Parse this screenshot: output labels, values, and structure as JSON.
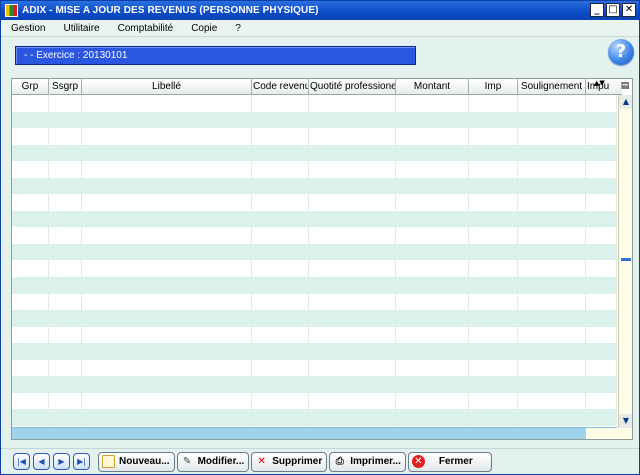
{
  "window": {
    "title": "ADIX - MISE A JOUR DES REVENUS (PERSONNE PHYSIQUE)",
    "minimize_glyph": "_",
    "maximize_glyph": "□",
    "close_glyph": "✕"
  },
  "menu": {
    "items": [
      {
        "label": "Gestion"
      },
      {
        "label": "Utilitaire"
      },
      {
        "label": "Comptabilité"
      },
      {
        "label": "Copie"
      },
      {
        "label": "?"
      }
    ]
  },
  "exercice": {
    "label": "- - Exercice : 20130101"
  },
  "grid": {
    "columns": [
      {
        "label": "Grp"
      },
      {
        "label": "Ssgrp"
      },
      {
        "label": "Libellé"
      },
      {
        "label": "Code revenu"
      },
      {
        "label": "Quotité professionelle"
      },
      {
        "label": "Montant"
      },
      {
        "label": "Imp"
      },
      {
        "label": "Soulignement"
      },
      {
        "label": "Impu"
      }
    ],
    "row_count": 20
  },
  "toolbar": {
    "nav": [
      {
        "glyph": "|◀"
      },
      {
        "glyph": "◀"
      },
      {
        "glyph": "▶"
      },
      {
        "glyph": "▶|"
      }
    ],
    "nouveau": "Nouveau...",
    "modifier": "Modifier...",
    "supprimer": "Supprimer",
    "imprimer": "Imprimer...",
    "fermer": "Fermer"
  },
  "icons": {
    "help": "?",
    "scroll_up": "▲",
    "scroll_down": "▼"
  }
}
